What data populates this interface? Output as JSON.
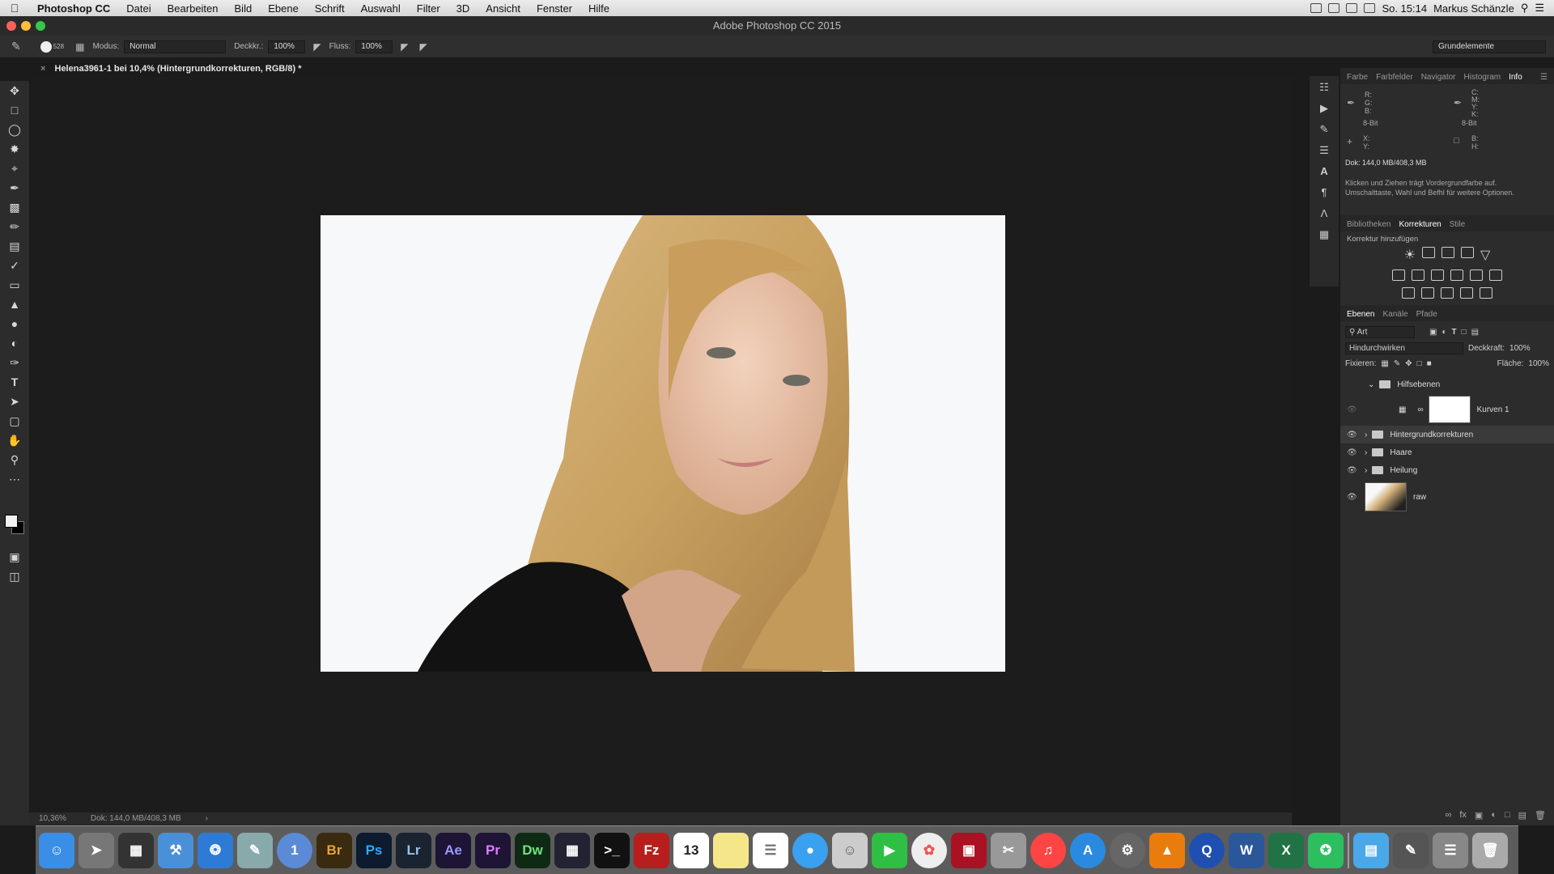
{
  "menubar": {
    "apple": "",
    "app_name": "Photoshop CC",
    "items": [
      "Datei",
      "Bearbeiten",
      "Bild",
      "Ebene",
      "Schrift",
      "Auswahl",
      "Filter",
      "3D",
      "Ansicht",
      "Fenster",
      "Hilfe"
    ],
    "clock": "So. 15:14",
    "user": "Markus Schänzle"
  },
  "window": {
    "title": "Adobe Photoshop CC 2015"
  },
  "options": {
    "brush_size": "528",
    "mode_label": "Modus:",
    "mode_value": "Normal",
    "opacity_label": "Deckkr.:",
    "opacity_value": "100%",
    "flow_label": "Fluss:",
    "flow_value": "100%",
    "workspace": "Grundelemente"
  },
  "document": {
    "tab_title": "Helena3961-1 bei 10,4% (Hintergrundkorrekturen, RGB/8) *"
  },
  "status": {
    "zoom": "10,36%",
    "doc": "Dok: 144,0 MB/408,3 MB"
  },
  "info_panel": {
    "tabs": [
      "Farbe",
      "Farbfelder",
      "Navigator",
      "Histogram",
      "Info"
    ],
    "active_tab": "Info",
    "rgb_labels": [
      "R:",
      "G:",
      "B:"
    ],
    "cmyk_labels": [
      "C:",
      "M:",
      "Y:",
      "K:"
    ],
    "bit_left": "8-Bit",
    "bit_right": "8-Bit",
    "xy_labels": [
      "X:",
      "Y:"
    ],
    "bh_labels": [
      "B:",
      "H:"
    ],
    "doc_size": "Dok: 144,0 MB/408,3 MB",
    "hint": "Klicken und Ziehen trägt Vordergrundfarbe auf. Umschalttaste, Wahl und Befhl für weitere Optionen."
  },
  "adjustments": {
    "tabs": [
      "Bibliotheken",
      "Korrekturen",
      "Stile"
    ],
    "active_tab": "Korrekturen",
    "header": "Korrektur hinzufügen"
  },
  "layers_panel": {
    "tabs": [
      "Ebenen",
      "Kanäle",
      "Pfade"
    ],
    "active_tab": "Ebenen",
    "filter": "Art",
    "blend": "Hindurchwirken",
    "opacity_label": "Deckkraft:",
    "opacity": "100%",
    "lock_label": "Fixieren:",
    "fill_label": "Fläche:",
    "fill": "100%",
    "layers": [
      {
        "name": "Hilfsebenen",
        "type": "group"
      },
      {
        "name": "Kurven 1",
        "type": "adjustment"
      },
      {
        "name": "Hintergrundkorrekturen",
        "type": "group"
      },
      {
        "name": "Haare",
        "type": "group"
      },
      {
        "name": "Heilung",
        "type": "group"
      },
      {
        "name": "raw",
        "type": "pixel"
      }
    ]
  },
  "dock": {
    "apps": [
      "Br",
      "Ps",
      "Lr",
      "Ae",
      "Pr",
      "Dw"
    ],
    "calendar_day": "13",
    "word": "W",
    "excel": "X"
  }
}
